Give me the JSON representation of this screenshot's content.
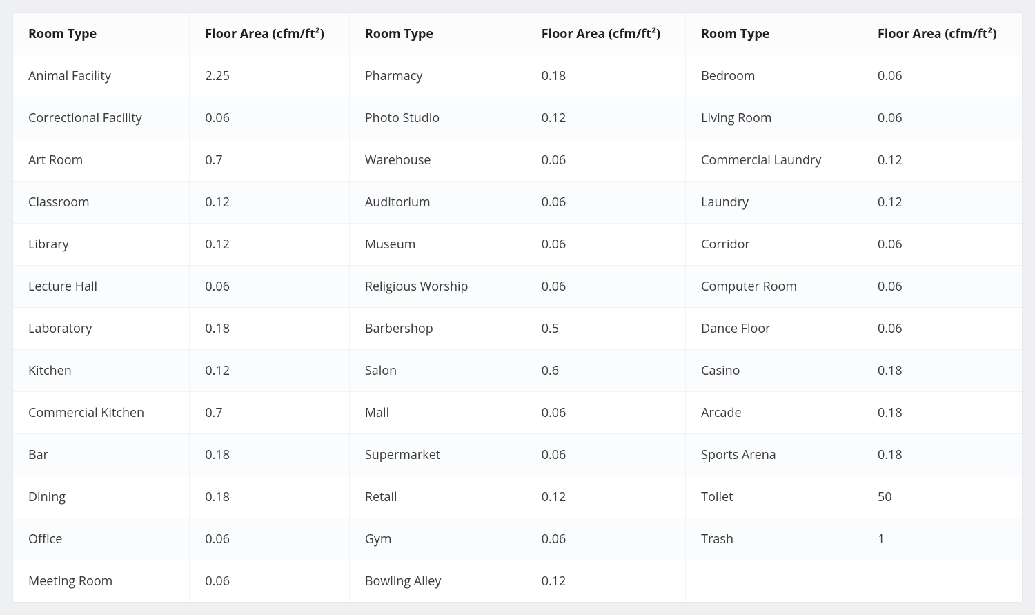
{
  "table": {
    "headers": {
      "room_type": "Room Type",
      "floor_area": "Floor Area (cfm/ft²)"
    },
    "rows": [
      {
        "c0": "Animal Facility",
        "c1": "2.25",
        "c2": "Pharmacy",
        "c3": "0.18",
        "c4": "Bedroom",
        "c5": "0.06"
      },
      {
        "c0": "Correctional Facility",
        "c1": "0.06",
        "c2": "Photo Studio",
        "c3": "0.12",
        "c4": "Living Room",
        "c5": "0.06"
      },
      {
        "c0": "Art Room",
        "c1": "0.7",
        "c2": "Warehouse",
        "c3": "0.06",
        "c4": "Commercial Laundry",
        "c5": "0.12"
      },
      {
        "c0": "Classroom",
        "c1": "0.12",
        "c2": "Auditorium",
        "c3": "0.06",
        "c4": "Laundry",
        "c5": "0.12"
      },
      {
        "c0": "Library",
        "c1": "0.12",
        "c2": "Museum",
        "c3": "0.06",
        "c4": "Corridor",
        "c5": "0.06"
      },
      {
        "c0": "Lecture Hall",
        "c1": "0.06",
        "c2": "Religious Worship",
        "c3": "0.06",
        "c4": "Computer Room",
        "c5": "0.06"
      },
      {
        "c0": "Laboratory",
        "c1": "0.18",
        "c2": "Barbershop",
        "c3": "0.5",
        "c4": "Dance Floor",
        "c5": "0.06"
      },
      {
        "c0": "Kitchen",
        "c1": "0.12",
        "c2": "Salon",
        "c3": "0.6",
        "c4": "Casino",
        "c5": "0.18"
      },
      {
        "c0": "Commercial Kitchen",
        "c1": "0.7",
        "c2": "Mall",
        "c3": "0.06",
        "c4": "Arcade",
        "c5": "0.18"
      },
      {
        "c0": "Bar",
        "c1": "0.18",
        "c2": "Supermarket",
        "c3": "0.06",
        "c4": "Sports Arena",
        "c5": "0.18"
      },
      {
        "c0": "Dining",
        "c1": "0.18",
        "c2": "Retail",
        "c3": "0.12",
        "c4": "Toilet",
        "c5": "50"
      },
      {
        "c0": "Office",
        "c1": "0.06",
        "c2": "Gym",
        "c3": "0.06",
        "c4": "Trash",
        "c5": "1"
      },
      {
        "c0": "Meeting Room",
        "c1": "0.06",
        "c2": "Bowling Alley",
        "c3": "0.12",
        "c4": "",
        "c5": ""
      }
    ]
  }
}
